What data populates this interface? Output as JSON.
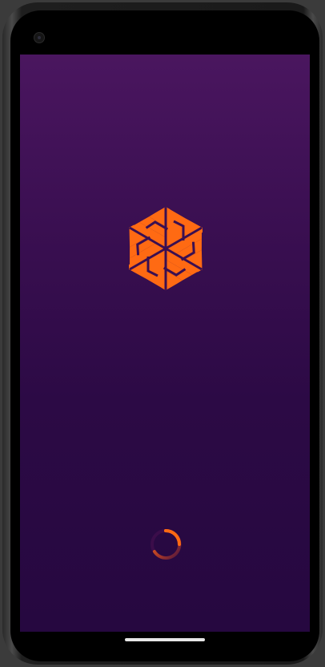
{
  "app": {
    "screen": "splash",
    "brand_color": "#ff6a13",
    "background_top": "#4a165f",
    "background_bottom": "#260840"
  },
  "icons": {
    "logo": "hexagon-swirl-logo-icon",
    "spinner": "loading-spinner-icon"
  },
  "device": {
    "home_indicator": true
  }
}
